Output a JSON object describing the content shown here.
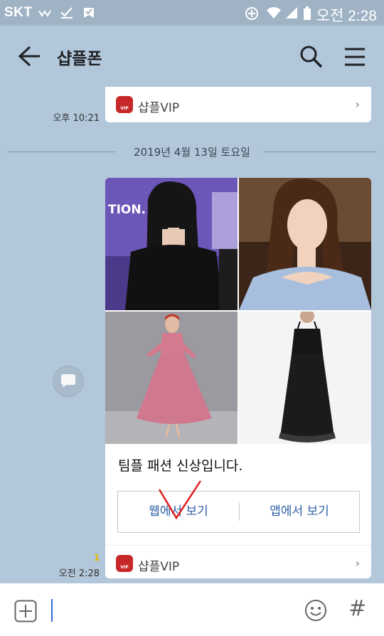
{
  "status_bar": {
    "carrier": "SKT",
    "time": "오전 2:28"
  },
  "app_bar": {
    "title": "샵플폰"
  },
  "chat": {
    "prev_card": {
      "sender": "샵플VIP",
      "logo_text": "VIP",
      "time": "오후 10:21"
    },
    "date_separator": "2019년 4월 13일 토요일",
    "message": {
      "text": "팀플 패션 신상입니다.",
      "buttons": [
        "웹에서 보기",
        "앱에서 보기"
      ],
      "sender": "샵플VIP",
      "logo_text": "VIP",
      "unread_count": "1",
      "time": "오전 2:28",
      "photos": [
        {
          "desc": "woman-black-offshoulder-dress"
        },
        {
          "desc": "woman-blue-offshoulder-top"
        },
        {
          "desc": "pink-lace-dress-model"
        },
        {
          "desc": "black-slip-dress"
        }
      ]
    }
  },
  "colors": {
    "chat_bg": "#b2c7da",
    "link_blue": "#2f5fa8",
    "annotation_red": "#e01e1e"
  }
}
